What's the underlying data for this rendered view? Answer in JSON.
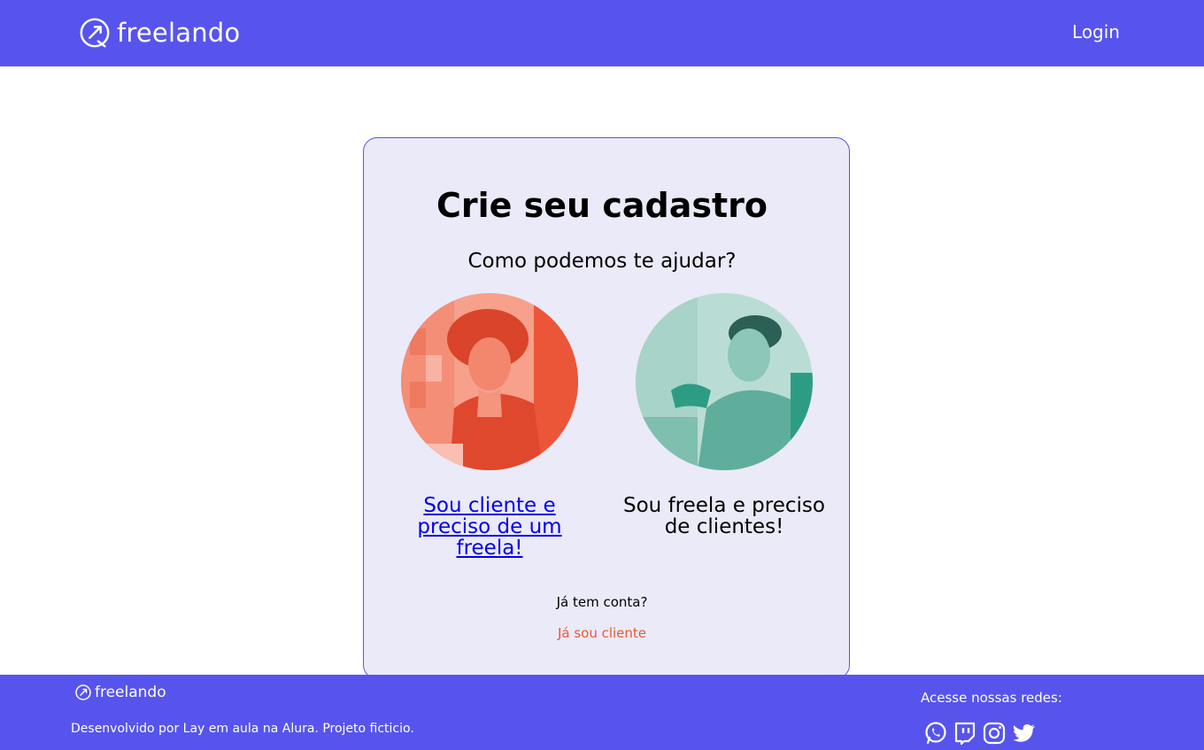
{
  "header": {
    "brand": "freelando",
    "login_label": "Login"
  },
  "signup": {
    "title": "Crie seu cadastro",
    "subtitle": "Como podemos te ajudar?",
    "option_client": "Sou cliente e preciso de um freela!",
    "option_freela": "Sou freela e preciso de clientes!",
    "has_account": "Já tem conta?",
    "already_client": "Já sou cliente"
  },
  "footer": {
    "brand": "freelando",
    "credit": "Desenvolvido por Lay em aula na Alura. Projeto ficticio.",
    "social_label": "Acesse nossas redes:",
    "social_icons": [
      "whatsapp-icon",
      "twitch-icon",
      "instagram-icon",
      "twitter-icon"
    ]
  },
  "colors": {
    "brand_primary": "#5754ED",
    "card_background": "#EBEAF8",
    "accent_coral": "#EB5638",
    "accent_teal": "#2E9C84",
    "link_blue": "#0000EE"
  }
}
